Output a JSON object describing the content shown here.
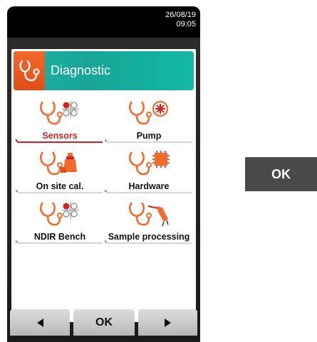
{
  "status": {
    "date": "26/08/19",
    "time": "09:05"
  },
  "header": {
    "title": "Diagnostic",
    "icon": "stethoscope-icon"
  },
  "menu": {
    "items": [
      {
        "label": "Sensors",
        "icon": "sensors-icon",
        "selected": true
      },
      {
        "label": "Pump",
        "icon": "pump-icon",
        "selected": false
      },
      {
        "label": "On site cal.",
        "icon": "calibration-icon",
        "selected": false
      },
      {
        "label": "Hardware",
        "icon": "chip-icon",
        "selected": false
      },
      {
        "label": "NDIR Bench",
        "icon": "ndir-icon",
        "selected": false
      },
      {
        "label": "Sample processing",
        "icon": "probe-icon",
        "selected": false
      }
    ]
  },
  "softkeys": {
    "left": "◄",
    "center": "OK",
    "right": "►"
  },
  "side_button": {
    "label": "OK"
  },
  "colors": {
    "accent_orange": "#f26a2c",
    "accent_teal": "#1db3a5",
    "selection_red": "#d42222"
  }
}
